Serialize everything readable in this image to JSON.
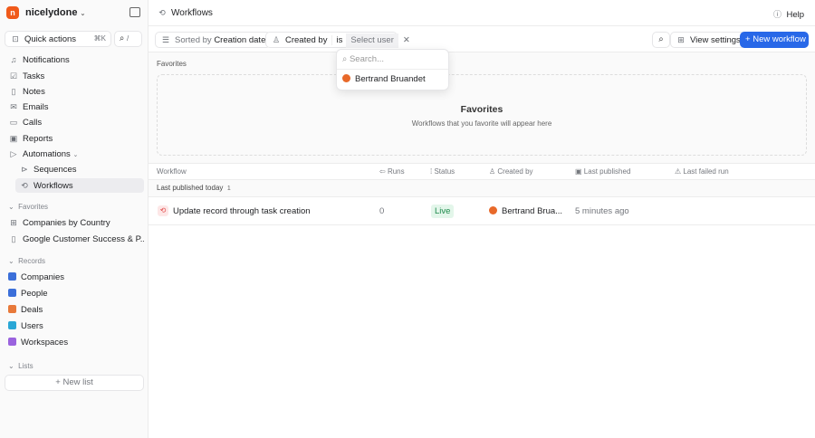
{
  "workspace": {
    "name": "nicelydone"
  },
  "sidebar": {
    "quick_actions": "Quick actions",
    "quick_shortcut": "⌘K",
    "search_shortcut": "/",
    "nav": [
      {
        "label": "Notifications",
        "icon": "bell-icon"
      },
      {
        "label": "Tasks",
        "icon": "check-square-icon"
      },
      {
        "label": "Notes",
        "icon": "note-icon"
      },
      {
        "label": "Emails",
        "icon": "mail-icon"
      },
      {
        "label": "Calls",
        "icon": "video-icon"
      },
      {
        "label": "Reports",
        "icon": "chart-icon"
      },
      {
        "label": "Automations",
        "icon": "play-icon"
      }
    ],
    "automations": [
      {
        "label": "Sequences"
      },
      {
        "label": "Workflows",
        "selected": true
      }
    ],
    "favorites_label": "Favorites",
    "favorites": [
      {
        "label": "Companies by Country"
      },
      {
        "label": "Google Customer Success & P..."
      }
    ],
    "records_label": "Records",
    "records": [
      {
        "label": "Companies",
        "color": "#3b6fd9"
      },
      {
        "label": "People",
        "color": "#3b6fd9"
      },
      {
        "label": "Deals",
        "color": "#e8793a"
      },
      {
        "label": "Users",
        "color": "#2aa7d6"
      },
      {
        "label": "Workspaces",
        "color": "#9a63de"
      }
    ],
    "lists_label": "Lists",
    "new_list": "New list"
  },
  "header": {
    "title": "Workflows",
    "help": "Help"
  },
  "toolbar": {
    "sorted_prefix": "Sorted by",
    "sorted_value": "Creation date",
    "filter_field": "Created by",
    "filter_op": "is",
    "filter_value_placeholder": "Select user",
    "view_settings": "View settings",
    "new_workflow": "New workflow",
    "accent": "#2868e8"
  },
  "dropdown": {
    "search_placeholder": "Search...",
    "options": [
      "Bertrand Bruandet"
    ]
  },
  "favorites": {
    "label": "Favorites",
    "empty_title": "Favorites",
    "empty_text": "Workflows that you favorite will appear here"
  },
  "table": {
    "columns": [
      "Workflow",
      "Runs",
      "Status",
      "Created by",
      "Last published",
      "Last failed run"
    ],
    "group": {
      "label": "Last published today",
      "count": "1"
    },
    "rows": [
      {
        "name": "Update record through task creation",
        "runs": "0",
        "status": "Live",
        "created_by": "Bertrand Brua...",
        "last_published": "5 minutes ago",
        "last_failed": ""
      }
    ]
  }
}
